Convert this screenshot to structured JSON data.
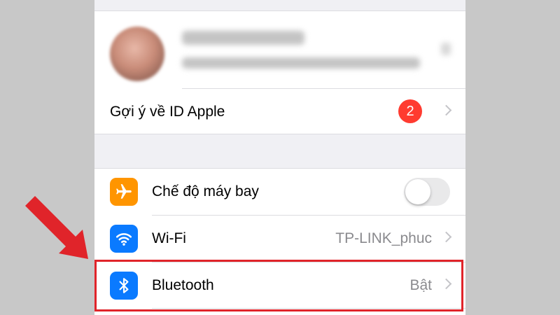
{
  "profile": {
    "name": "",
    "subtitle": ""
  },
  "account": {
    "apple_id_suggestions_label": "Gợi ý về ID Apple",
    "badge_count": "2"
  },
  "network": {
    "airplane": {
      "label": "Chế độ máy bay",
      "icon": "airplane-icon",
      "toggle_on": false,
      "icon_color": "#ff9500"
    },
    "wifi": {
      "label": "Wi-Fi",
      "value": "TP-LINK_phuc",
      "icon": "wifi-icon",
      "icon_color": "#0a7aff"
    },
    "bluetooth": {
      "label": "Bluetooth",
      "value": "Bật",
      "icon": "bluetooth-icon",
      "icon_color": "#0a7aff"
    }
  },
  "annotation": {
    "highlight_color": "#e0242a",
    "arrow_color": "#e0242a"
  }
}
